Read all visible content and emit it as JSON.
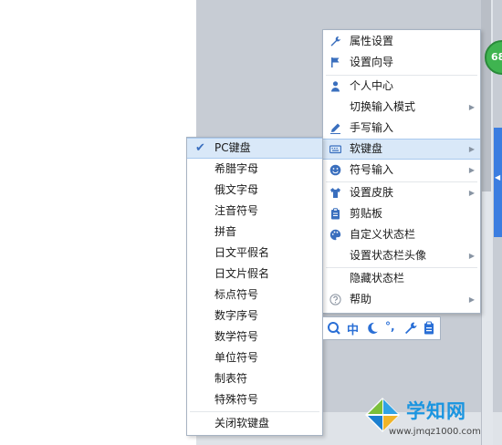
{
  "colors": {
    "accent": "#3a6fbe",
    "highlight": "#d9e8f8",
    "badge": "#3fb450",
    "logo": "#1b95e0"
  },
  "badge": {
    "text": "68"
  },
  "main_menu": {
    "items": [
      {
        "label": "属性设置",
        "icon": "wrench-icon"
      },
      {
        "label": "设置向导",
        "icon": "flag-icon"
      },
      {
        "label": "个人中心",
        "icon": "user-icon"
      },
      {
        "label": "切换输入模式",
        "icon": "",
        "has_submenu": true
      },
      {
        "label": "手写输入",
        "icon": "pen-icon"
      },
      {
        "label": "软键盘",
        "icon": "keyboard-icon",
        "has_submenu": true,
        "highlighted": true
      },
      {
        "label": "符号输入",
        "icon": "smile-icon",
        "has_submenu": true
      },
      {
        "label": "设置皮肤",
        "icon": "shirt-icon",
        "has_submenu": true
      },
      {
        "label": "剪贴板",
        "icon": "clipboard-icon"
      },
      {
        "label": "自定义状态栏",
        "icon": "palette-icon"
      },
      {
        "label": "设置状态栏头像",
        "icon": "",
        "has_submenu": true
      },
      {
        "label": "隐藏状态栏",
        "icon": ""
      },
      {
        "label": "帮助",
        "icon": "help-icon",
        "has_submenu": true
      }
    ]
  },
  "soft_keyboard_menu": {
    "items": [
      {
        "label": "PC键盘",
        "checked": true
      },
      {
        "label": "希腊字母"
      },
      {
        "label": "俄文字母"
      },
      {
        "label": "注音符号"
      },
      {
        "label": "拼音"
      },
      {
        "label": "日文平假名"
      },
      {
        "label": "日文片假名"
      },
      {
        "label": "标点符号"
      },
      {
        "label": "数字序号"
      },
      {
        "label": "数学符号"
      },
      {
        "label": "单位符号"
      },
      {
        "label": "制表符"
      },
      {
        "label": "特殊符号"
      },
      {
        "label": "关闭软键盘"
      }
    ]
  },
  "status_bar": {
    "items": [
      {
        "icon": "search-icon"
      },
      {
        "text": "中",
        "icon": "chinese-mode"
      },
      {
        "icon": "moon-icon"
      },
      {
        "text": "°,",
        "icon": "punctuation-icon"
      },
      {
        "icon": "wrench-icon"
      },
      {
        "icon": "clipboard-icon"
      }
    ]
  },
  "watermark": {
    "title": "学知网",
    "url": "www.jmqz1000.com"
  }
}
